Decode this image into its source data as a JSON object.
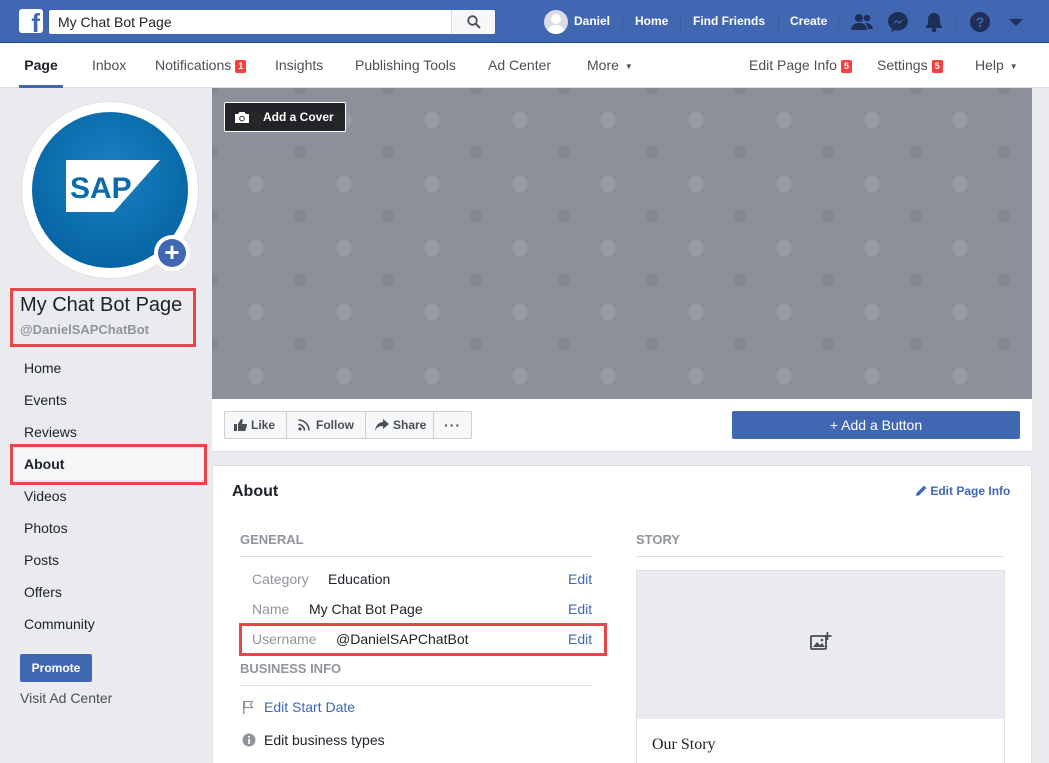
{
  "topbar": {
    "search_value": "My Chat Bot Page",
    "user_name": "Daniel",
    "home": "Home",
    "find_friends": "Find Friends",
    "create": "Create",
    "logo_letter": "f"
  },
  "pagebar": {
    "tabs": [
      {
        "label": "Page"
      },
      {
        "label": "Inbox"
      },
      {
        "label": "Notifications",
        "badge": "1"
      },
      {
        "label": "Insights"
      },
      {
        "label": "Publishing Tools"
      },
      {
        "label": "Ad Center"
      },
      {
        "label": "More"
      }
    ],
    "edit_page_info": "Edit Page Info",
    "edit_page_info_badge": "5",
    "settings": "Settings",
    "settings_badge": "5",
    "help": "Help"
  },
  "page": {
    "title": "My Chat Bot Page",
    "handle": "@DanielSAPChatBot",
    "logo_text": "SAP"
  },
  "sidebar": {
    "items": [
      "Home",
      "Events",
      "Reviews",
      "About",
      "Videos",
      "Photos",
      "Posts",
      "Offers",
      "Community"
    ],
    "active": "About",
    "promote": "Promote",
    "visit_ad_center": "Visit Ad Center"
  },
  "cover": {
    "add_cover": "Add a Cover"
  },
  "actions": {
    "like": "Like",
    "follow": "Follow",
    "share": "Share",
    "add_button": "+ Add a Button"
  },
  "about": {
    "title": "About",
    "edit_page_info": "Edit Page Info",
    "general_heading": "GENERAL",
    "rows": [
      {
        "label": "Category",
        "value": "Education",
        "edit": "Edit"
      },
      {
        "label": "Name",
        "value": "My Chat Bot Page",
        "edit": "Edit"
      },
      {
        "label": "Username",
        "value": "@DanielSAPChatBot",
        "edit": "Edit"
      }
    ],
    "business_heading": "BUSINESS INFO",
    "edit_start_date": "Edit Start Date",
    "edit_business_types": "Edit business types",
    "story_heading": "STORY",
    "our_story": "Our Story"
  },
  "colors": {
    "brand_blue": "#4267b2",
    "highlight_red": "#e8474a",
    "badge_red": "#fa3e3e"
  }
}
